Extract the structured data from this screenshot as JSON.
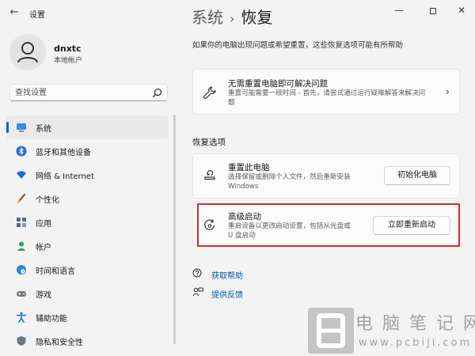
{
  "window": {
    "app_title": "设置",
    "back_glyph": "←",
    "min_glyph": "—",
    "close_glyph": "✕"
  },
  "user": {
    "name": "dnxtc",
    "account_type": "本地帐户"
  },
  "search": {
    "placeholder": "查找设置"
  },
  "sidebar": {
    "items": [
      {
        "label": "系统",
        "icon": "system-monitor-icon",
        "active": true
      },
      {
        "label": "蓝牙和其他设备",
        "icon": "bluetooth-icon",
        "active": false
      },
      {
        "label": "网络 & Internet",
        "icon": "wifi-icon",
        "active": false
      },
      {
        "label": "个性化",
        "icon": "paintbrush-icon",
        "active": false
      },
      {
        "label": "应用",
        "icon": "apps-grid-icon",
        "active": false
      },
      {
        "label": "帐户",
        "icon": "account-person-icon",
        "active": false
      },
      {
        "label": "时间和语言",
        "icon": "globe-clock-icon",
        "active": false
      },
      {
        "label": "游戏",
        "icon": "game-controller-icon",
        "active": false
      },
      {
        "label": "辅助功能",
        "icon": "accessibility-icon",
        "active": false
      },
      {
        "label": "隐私和安全性",
        "icon": "shield-icon",
        "active": false
      }
    ]
  },
  "main": {
    "breadcrumb_parent": "系统",
    "breadcrumb_separator": "›",
    "page_title": "恢复",
    "description": "如果你的电脑出现问题或希望重置，这些恢复选项可能有所帮助",
    "troubleshoot_card": {
      "title": "无需重置电脑即可解决问题",
      "desc_line1": "重置可能需要一段时间 - 首先，请尝试通过运行疑难解答来解决问",
      "desc_line2": "题",
      "chevron": "›"
    },
    "section_title": "恢复选项",
    "reset_card": {
      "title": "重置此电脑",
      "desc_line1": "选择保留或删除个人文件，然后重新安装",
      "desc_line2": "Windows",
      "button": "初始化电脑"
    },
    "advanced_card": {
      "title": "高级启动",
      "desc_line1": "重启设备以更改启动设置，包括从光盘或",
      "desc_line2": "U 盘启动",
      "button": "立即重新启动"
    },
    "links": [
      {
        "label": "获取帮助",
        "icon": "help-icon"
      },
      {
        "label": "提供反馈",
        "icon": "feedback-icon"
      }
    ]
  },
  "watermark": {
    "title": "电脑笔记网",
    "url": "www.pcbiji.com"
  },
  "colors": {
    "accent": "#0067c0",
    "highlight": "#e0262b",
    "link": "#0058a8"
  }
}
